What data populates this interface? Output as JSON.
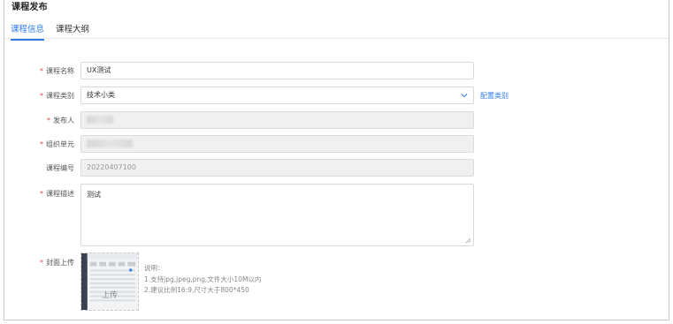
{
  "page": {
    "title": "课程发布"
  },
  "tabs": [
    {
      "label": "课程信息",
      "active": true
    },
    {
      "label": "课程大纲",
      "active": false
    }
  ],
  "form": {
    "required_mark": "*",
    "course_name": {
      "label": "课程名称",
      "value": "UX测试"
    },
    "course_category": {
      "label": "课程类别",
      "value": "技术小类",
      "config_link": "配置类别"
    },
    "publisher": {
      "label": "发布人"
    },
    "org_unit": {
      "label": "组织单元"
    },
    "course_code": {
      "label": "课程编号",
      "value": "20220407100"
    },
    "course_desc": {
      "label": "课程描述",
      "value": "测试"
    },
    "cover": {
      "label": "封面上传",
      "upload_label": "上传",
      "hint_title": "说明：",
      "hint_line1": "1.支持jpg,jpeg,png,文件大小10M以内",
      "hint_line2": "2.建议比例16:9,尺寸大于800*450"
    }
  },
  "colors": {
    "accent": "#2f7be5",
    "required": "#e34d4d",
    "disabled_bg": "#f0f0f0"
  }
}
